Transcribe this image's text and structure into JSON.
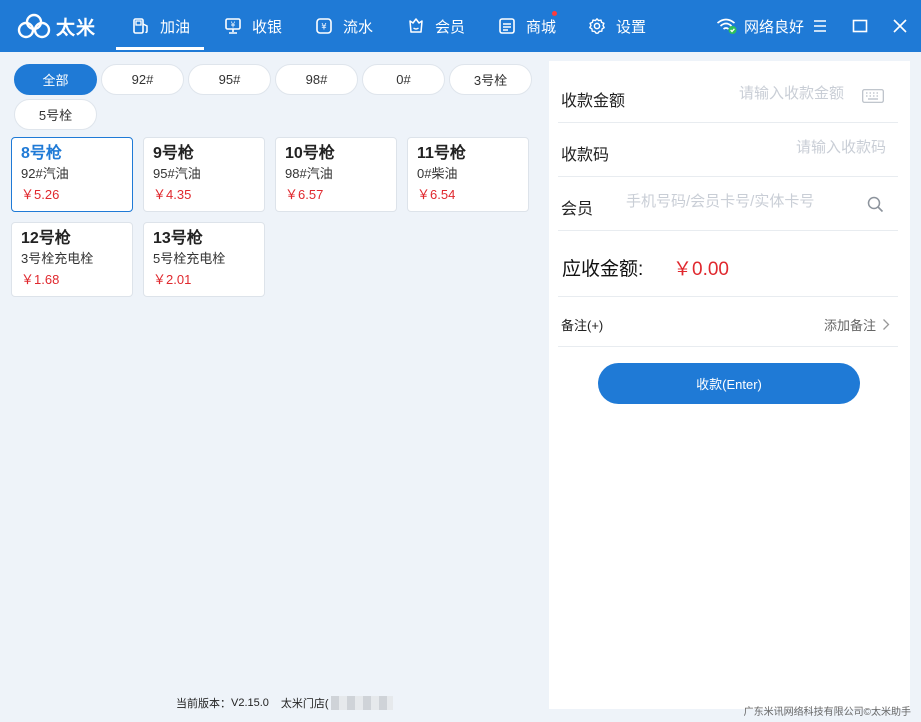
{
  "header": {
    "logo_text": "太米",
    "nav": [
      {
        "label": "加油",
        "icon": "fuel-pump-icon",
        "active": true
      },
      {
        "label": "收银",
        "icon": "cashier-icon"
      },
      {
        "label": "流水",
        "icon": "transactions-icon"
      },
      {
        "label": "会员",
        "icon": "member-icon"
      },
      {
        "label": "商城",
        "icon": "mall-icon",
        "badge": true
      },
      {
        "label": "设置",
        "icon": "settings-icon"
      }
    ],
    "network_label": "网络良好",
    "accent_color": "#1f7ad6",
    "badge_color": "#ff3b3b"
  },
  "filters": [
    "全部",
    "92#",
    "95#",
    "98#",
    "0#",
    "3号栓",
    "5号栓"
  ],
  "active_filter": "全部",
  "nozzles": [
    {
      "name": "8号枪",
      "fuel": "92#汽油",
      "price": "￥5.26"
    },
    {
      "name": "9号枪",
      "fuel": "95#汽油",
      "price": "￥4.35"
    },
    {
      "name": "10号枪",
      "fuel": "98#汽油",
      "price": "￥6.57"
    },
    {
      "name": "11号枪",
      "fuel": "0#柴油",
      "price": "￥6.54"
    },
    {
      "name": "12号枪",
      "fuel": "3号栓充电栓",
      "price": "￥1.68"
    },
    {
      "name": "13号枪",
      "fuel": "5号栓充电栓",
      "price": "￥2.01"
    }
  ],
  "active_nozzle": "8号枪",
  "payment": {
    "amount_label": "收款金额",
    "amount_placeholder": "请输入收款金额",
    "amount_value": "",
    "code_label": "收款码",
    "code_placeholder": "请输入收款码",
    "code_value": "",
    "member_label": "会员",
    "member_placeholder": "手机号码/会员卡号/实体卡号",
    "member_value": "",
    "due_label": "应收金额:",
    "due_value": "￥0.00",
    "remark_label": "备注(+)",
    "remark_add": "添加备注",
    "pay_button": "收款(Enter)"
  },
  "footer": {
    "version_label": "当前版本：",
    "version": "V2.15.0",
    "store": "太米门店(",
    "copyright": "广东米讯网络科技有限公司©太米助手"
  }
}
